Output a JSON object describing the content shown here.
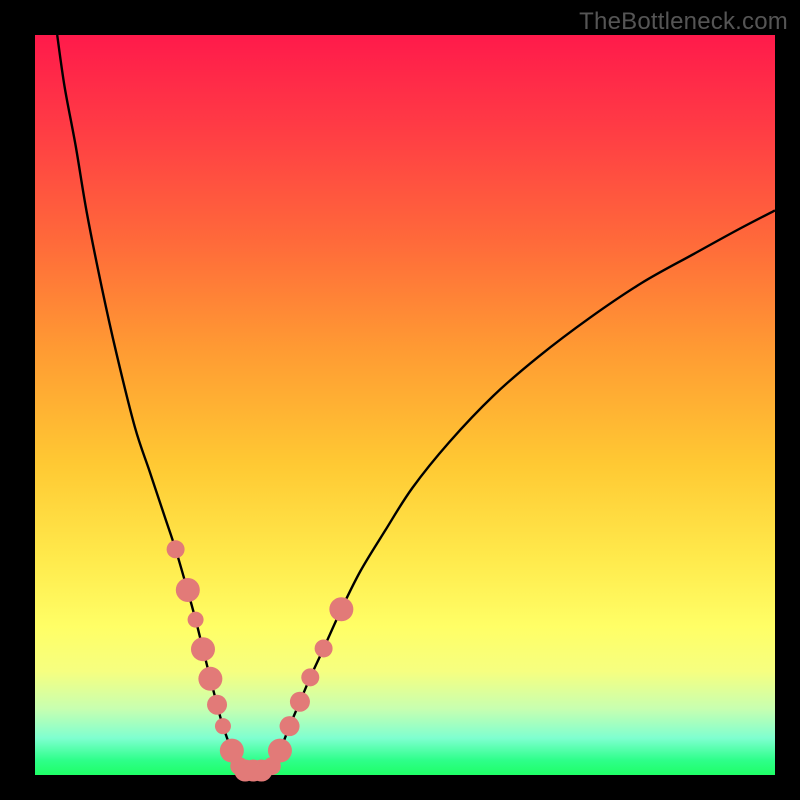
{
  "watermark": "TheBottleneck.com",
  "colors": {
    "frame": "#000000",
    "curve_stroke": "#000000",
    "marker_fill": "#e27a78",
    "marker_stroke": "#b85552",
    "gradient_top": "#ff1a4b",
    "gradient_bottom": "#1fff66"
  },
  "chart_data": {
    "type": "line",
    "title": "",
    "xlabel": "",
    "ylabel": "",
    "xlim": [
      0,
      100
    ],
    "ylim": [
      0,
      100
    ],
    "curve_left": {
      "name": "left-arm",
      "x": [
        3.0,
        4.0,
        5.5,
        7.0,
        9.0,
        11.0,
        13.5,
        15.5,
        17.5,
        19.0,
        20.6,
        21.7,
        22.7,
        23.7,
        24.6,
        25.4,
        26.6,
        27.6,
        28.0
      ],
      "y": [
        100,
        93,
        85,
        76,
        66,
        57,
        47,
        41,
        35,
        30.5,
        25,
        21,
        17,
        13,
        9.5,
        6.6,
        3.3,
        1.2,
        0.6
      ]
    },
    "curve_right": {
      "name": "right-arm",
      "x": [
        31.0,
        32.0,
        33.1,
        34.4,
        35.8,
        37.2,
        39.0,
        41.4,
        44.0,
        47.3,
        51.0,
        56.0,
        62.0,
        68.0,
        75.0,
        82.0,
        89.0,
        95.0,
        100.0
      ],
      "y": [
        0.6,
        1.2,
        3.3,
        6.6,
        9.9,
        13.2,
        17.1,
        22.4,
        27.6,
        33.0,
        38.8,
        45.0,
        51.3,
        56.5,
        61.8,
        66.5,
        70.4,
        73.7,
        76.3
      ]
    },
    "markers_left": {
      "name": "left-markers",
      "x": [
        19.0,
        20.65,
        21.7,
        22.7,
        23.7,
        24.6,
        25.4,
        26.6,
        27.6
      ],
      "y": [
        30.5,
        25.0,
        21.0,
        17.0,
        13.0,
        9.5,
        6.6,
        3.3,
        1.2
      ],
      "r": [
        9,
        12,
        8,
        12,
        12,
        10,
        8,
        12,
        9
      ]
    },
    "markers_right": {
      "name": "right-markers",
      "x": [
        32.0,
        33.1,
        34.4,
        35.8,
        37.2,
        39.0,
        41.4
      ],
      "y": [
        1.2,
        3.3,
        6.6,
        9.9,
        13.2,
        17.1,
        22.4
      ],
      "r": [
        9,
        12,
        10,
        10,
        9,
        9,
        12
      ]
    },
    "markers_bottom": {
      "name": "bottom-markers",
      "x": [
        28.4,
        29.5,
        30.6
      ],
      "y": [
        0.6,
        0.6,
        0.6
      ],
      "r": [
        11,
        11,
        11
      ]
    }
  }
}
